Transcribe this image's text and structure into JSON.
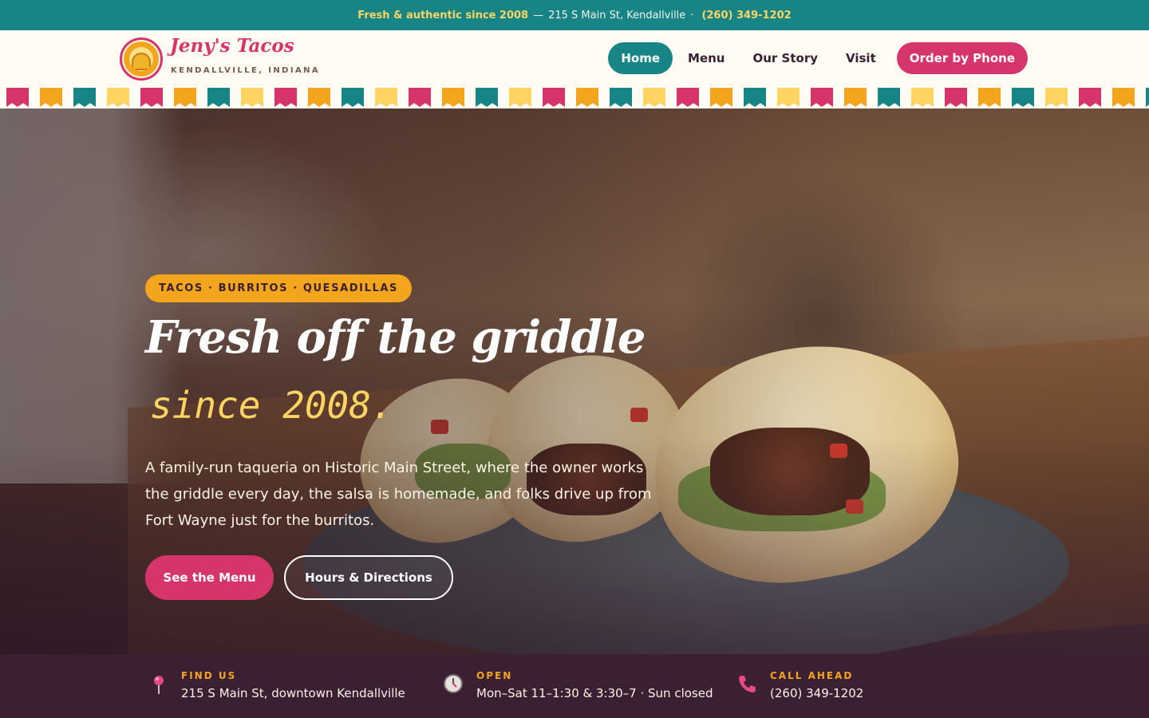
{
  "topbar": {
    "tagline": "Fresh & authentic since 2008",
    "dash": "—",
    "address": "215 S Main St, Kendallville",
    "dot": "·",
    "phone": "(260) 349-1202"
  },
  "brand": {
    "name": "Jeny's Tacos",
    "location": "KENDALLVILLE, INDIANA"
  },
  "nav": {
    "items": [
      {
        "label": "Home",
        "active": true
      },
      {
        "label": "Menu",
        "active": false
      },
      {
        "label": "Our Story",
        "active": false
      },
      {
        "label": "Visit",
        "active": false
      }
    ],
    "cta": "Order by Phone"
  },
  "hero": {
    "badge": "TACOS · BURRITOS · QUESADILLAS",
    "headline": "Fresh off the griddle",
    "headline_accent": "since 2008.",
    "lede": "A family-run taqueria on Historic Main Street, where the owner works the griddle every day, the salsa is homemade, and folks drive up from Fort Wayne just for the burritos.",
    "primary_button": "See the Menu",
    "secondary_button": "Hours & Directions"
  },
  "info": {
    "find": {
      "label": "FIND US",
      "value": "215 S Main St, downtown Kendallville",
      "icon": "map-pin-icon"
    },
    "open": {
      "label": "OPEN",
      "value": "Mon–Sat 11–1:30 & 3:30–7 · Sun closed",
      "icon": "clock-icon"
    },
    "call": {
      "label": "CALL AHEAD",
      "value": "(260) 349-1202",
      "icon": "phone-icon"
    }
  },
  "colors": {
    "teal": "#178585",
    "pink": "#d6356b",
    "orange": "#f3a51d",
    "yellow": "#ffd463",
    "plum": "#3a2032",
    "cream": "#fffcf3"
  }
}
